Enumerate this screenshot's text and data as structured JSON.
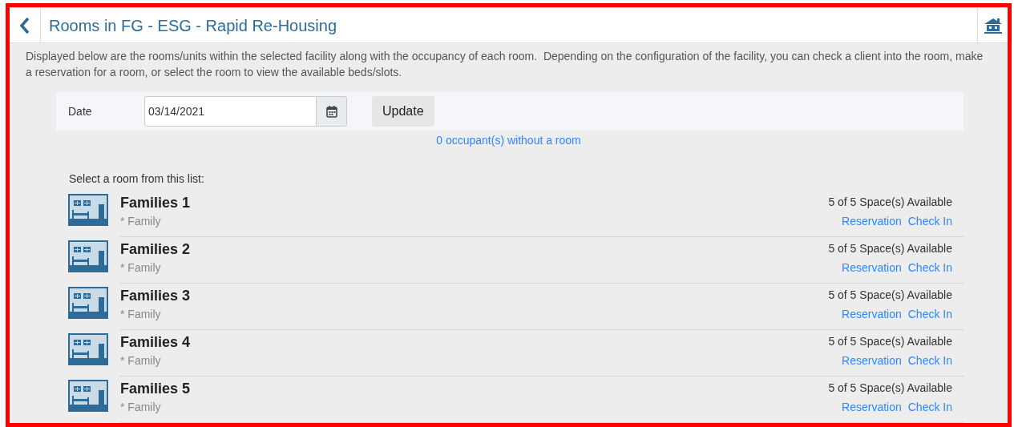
{
  "header": {
    "title": "Rooms in FG - ESG - Rapid Re-Housing"
  },
  "description": "Displayed below are the rooms/units within the selected facility along with the occupancy of each room.  Depending on the configuration of the facility, you can check a client into the room, make a reservation for a room, or select the room to view the available beds/slots.",
  "date_form": {
    "label": "Date",
    "value": "03/14/2021",
    "button": "Update"
  },
  "occupants_link": "0 occupant(s) without a room",
  "list_heading": "Select a room from this list:",
  "rooms": [
    {
      "name": "Families 1",
      "type": "* Family",
      "availability": "5 of 5 Space(s) Available",
      "actions": [
        "Reservation",
        "Check In"
      ]
    },
    {
      "name": "Families 2",
      "type": "* Family",
      "availability": "5 of 5 Space(s) Available",
      "actions": [
        "Reservation",
        "Check In"
      ]
    },
    {
      "name": "Families 3",
      "type": "* Family",
      "availability": "5 of 5 Space(s) Available",
      "actions": [
        "Reservation",
        "Check In"
      ]
    },
    {
      "name": "Families 4",
      "type": "* Family",
      "availability": "5 of 5 Space(s) Available",
      "actions": [
        "Reservation",
        "Check In"
      ]
    },
    {
      "name": "Families 5",
      "type": "* Family",
      "availability": "5 of 5 Space(s) Available",
      "actions": [
        "Reservation",
        "Check In"
      ]
    }
  ]
}
